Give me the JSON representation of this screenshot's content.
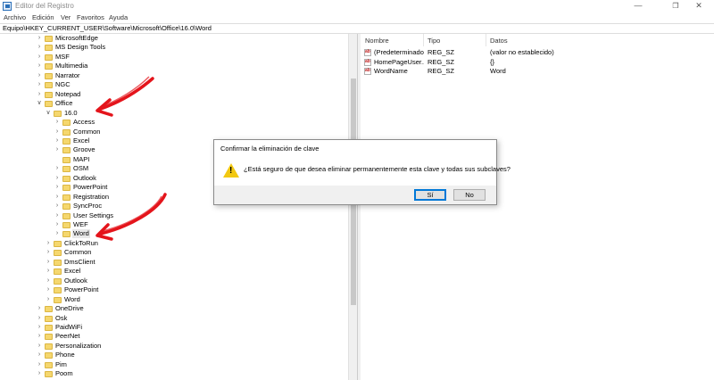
{
  "window": {
    "title": "Editor del Registro",
    "controls": [
      "—",
      "❐",
      "✕"
    ]
  },
  "menu": [
    "Archivo",
    "Edición",
    "Ver",
    "Favoritos",
    "Ayuda"
  ],
  "address": "Equipo\\HKEY_CURRENT_USER\\Software\\Microsoft\\Office\\16.0\\Word",
  "tree": [
    {
      "label": "MicrosoftEdge",
      "level": 0,
      "state": "collapsed"
    },
    {
      "label": "MS Design Tools",
      "level": 0,
      "state": "collapsed"
    },
    {
      "label": "MSF",
      "level": 0,
      "state": "collapsed"
    },
    {
      "label": "Multimedia",
      "level": 0,
      "state": "collapsed"
    },
    {
      "label": "Narrator",
      "level": 0,
      "state": "collapsed"
    },
    {
      "label": "NGC",
      "level": 0,
      "state": "collapsed"
    },
    {
      "label": "Notepad",
      "level": 0,
      "state": "collapsed"
    },
    {
      "label": "Office",
      "level": 0,
      "state": "expanded"
    },
    {
      "label": "16.0",
      "level": 1,
      "state": "expanded"
    },
    {
      "label": "Access",
      "level": 2,
      "state": "collapsed"
    },
    {
      "label": "Common",
      "level": 2,
      "state": "collapsed"
    },
    {
      "label": "Excel",
      "level": 2,
      "state": "collapsed"
    },
    {
      "label": "Groove",
      "level": 2,
      "state": "collapsed"
    },
    {
      "label": "MAPI",
      "level": 2,
      "state": "none"
    },
    {
      "label": "OSM",
      "level": 2,
      "state": "collapsed"
    },
    {
      "label": "Outlook",
      "level": 2,
      "state": "collapsed"
    },
    {
      "label": "PowerPoint",
      "level": 2,
      "state": "collapsed"
    },
    {
      "label": "Registration",
      "level": 2,
      "state": "collapsed"
    },
    {
      "label": "SyncProc",
      "level": 2,
      "state": "collapsed"
    },
    {
      "label": "User Settings",
      "level": 2,
      "state": "collapsed"
    },
    {
      "label": "WEF",
      "level": 2,
      "state": "collapsed"
    },
    {
      "label": "Word",
      "level": 2,
      "state": "collapsed",
      "selected": true
    },
    {
      "label": "ClickToRun",
      "level": 1,
      "state": "collapsed"
    },
    {
      "label": "Common",
      "level": 1,
      "state": "collapsed"
    },
    {
      "label": "DmsClient",
      "level": 1,
      "state": "collapsed"
    },
    {
      "label": "Excel",
      "level": 1,
      "state": "collapsed"
    },
    {
      "label": "Outlook",
      "level": 1,
      "state": "collapsed"
    },
    {
      "label": "PowerPoint",
      "level": 1,
      "state": "collapsed"
    },
    {
      "label": "Word",
      "level": 1,
      "state": "collapsed"
    },
    {
      "label": "OneDrive",
      "level": 0,
      "state": "collapsed"
    },
    {
      "label": "Osk",
      "level": 0,
      "state": "collapsed"
    },
    {
      "label": "PaidWiFi",
      "level": 0,
      "state": "collapsed"
    },
    {
      "label": "PeerNet",
      "level": 0,
      "state": "collapsed"
    },
    {
      "label": "Personalization",
      "level": 0,
      "state": "collapsed"
    },
    {
      "label": "Phone",
      "level": 0,
      "state": "collapsed"
    },
    {
      "label": "Pim",
      "level": 0,
      "state": "collapsed"
    },
    {
      "label": "Poom",
      "level": 0,
      "state": "collapsed"
    }
  ],
  "list": {
    "headers": {
      "name": "Nombre",
      "type": "Tipo",
      "data": "Datos"
    },
    "rows": [
      {
        "name": "(Predeterminado)",
        "type": "REG_SZ",
        "data": "(valor no establecido)"
      },
      {
        "name": "HomePageUser...",
        "type": "REG_SZ",
        "data": "{}"
      },
      {
        "name": "WordName",
        "type": "REG_SZ",
        "data": "Word"
      }
    ]
  },
  "dialog": {
    "title": "Confirmar la eliminación de clave",
    "message": "¿Está seguro de que desea eliminar permanentemente esta clave y todas sus subclaves?",
    "yes": "Sí",
    "no": "No"
  },
  "colors": {
    "arrow": "#e4141b",
    "folder": "#f5d76e",
    "accent": "#0078d7"
  }
}
